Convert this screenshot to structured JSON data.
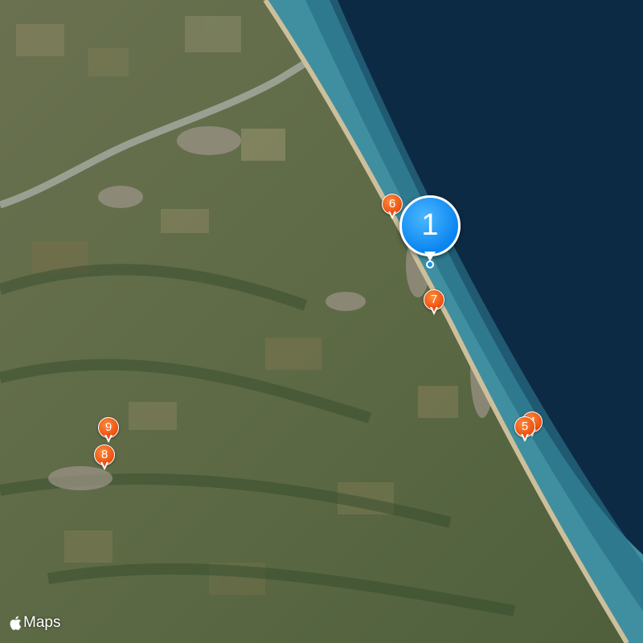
{
  "map": {
    "type": "satellite",
    "colors": {
      "sea": "#0d2a44",
      "shallow": "#3f8fa0",
      "beach": "#cdbf9c",
      "land": "#5e6b47",
      "selected_pin": "#0a84f0",
      "pin": "#ec4f10"
    }
  },
  "pins": [
    {
      "id": "pin-1",
      "label": "1",
      "selected": true
    },
    {
      "id": "pin-4",
      "label": "4",
      "selected": false
    },
    {
      "id": "pin-5",
      "label": "5",
      "selected": false
    },
    {
      "id": "pin-6",
      "label": "6",
      "selected": false
    },
    {
      "id": "pin-7",
      "label": "7",
      "selected": false
    },
    {
      "id": "pin-8",
      "label": "8",
      "selected": false
    },
    {
      "id": "pin-9",
      "label": "9",
      "selected": false
    }
  ],
  "attribution": {
    "logo_icon": "apple-logo-icon",
    "text": "Maps"
  }
}
